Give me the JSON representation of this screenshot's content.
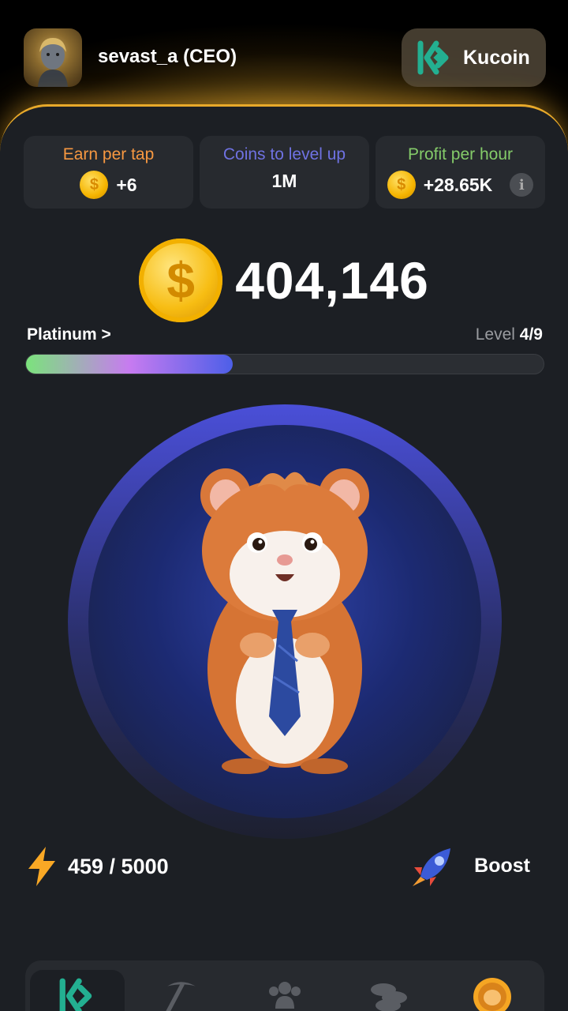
{
  "header": {
    "username": "sevast_a (CEO)",
    "exchange_label": "Kucoin"
  },
  "stats": {
    "earn_per_tap": {
      "title": "Earn per tap",
      "value": "+6",
      "color": "#f79841"
    },
    "coins_to_level": {
      "title": "Coins to level up",
      "value": "1M",
      "color": "#6f72e2"
    },
    "profit_per_hour": {
      "title": "Profit per hour",
      "value": "+28.65K",
      "color": "#84cb69"
    }
  },
  "balance": {
    "amount": "404,146"
  },
  "level": {
    "league": "Platinum >",
    "prefix": "Level ",
    "current": "4/9",
    "progress_fraction": 0.4
  },
  "energy": {
    "text": "459 / 5000"
  },
  "boost": {
    "label": "Boost"
  },
  "nav": {
    "items": [
      {
        "icon": "kucoin-logo-icon",
        "active": true
      },
      {
        "icon": "pickaxe-icon",
        "active": false
      },
      {
        "icon": "friends-icon",
        "active": false
      },
      {
        "icon": "coins-stack-icon",
        "active": false
      },
      {
        "icon": "hamster-coin-icon",
        "active": false
      }
    ]
  },
  "colors": {
    "accent_gold": "#e8a92a",
    "kucoin_green": "#23af91",
    "panel_bg": "#1c1f24"
  }
}
